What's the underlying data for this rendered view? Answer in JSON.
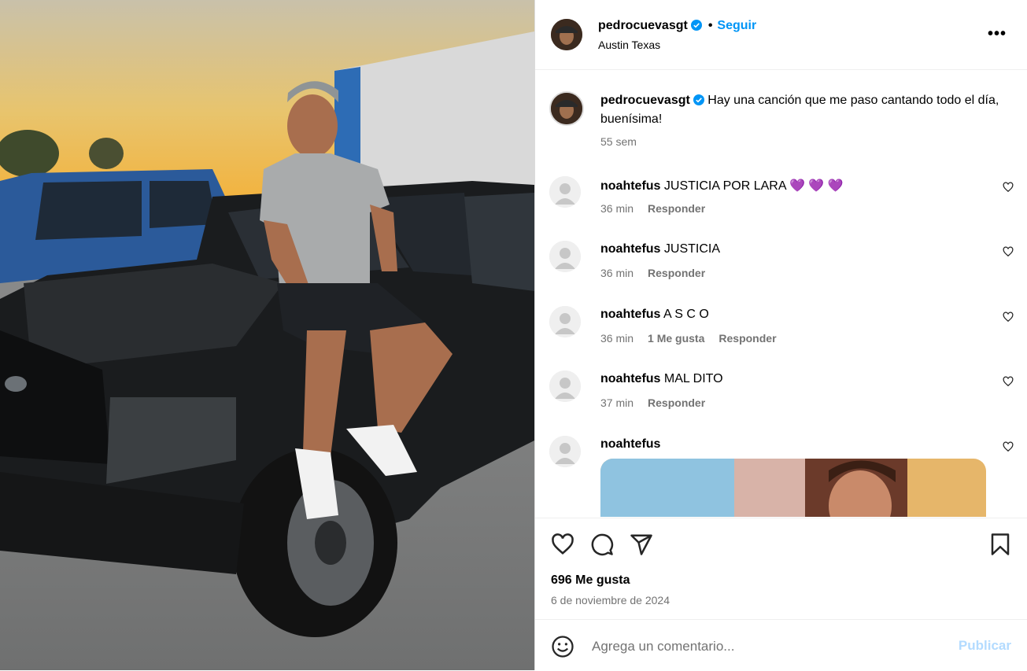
{
  "post": {
    "username": "pedrocuevasgt",
    "follow_label": "Seguir",
    "location": "Austin Texas",
    "more_label": "•••",
    "separator": "•"
  },
  "caption": {
    "username": "pedrocuevasgt",
    "text": "Hay una canción que me paso cantando todo el día, buenísima!",
    "time": "55 sem"
  },
  "comments": [
    {
      "username": "noahtefus",
      "text": "JUSTICIA POR LARA 💜 💜 💜",
      "time": "36 min",
      "likes": "",
      "reply": "Responder"
    },
    {
      "username": "noahtefus",
      "text": "JUSTICIA",
      "time": "36 min",
      "likes": "",
      "reply": "Responder"
    },
    {
      "username": "noahtefus",
      "text": "A S C O",
      "time": "36 min",
      "likes": "1 Me gusta",
      "reply": "Responder"
    },
    {
      "username": "noahtefus",
      "text": "MAL DITO",
      "time": "37 min",
      "likes": "",
      "reply": "Responder"
    },
    {
      "username": "noahtefus",
      "text": "",
      "time": "",
      "likes": "",
      "reply": ""
    }
  ],
  "stats": {
    "likes": "696 Me gusta",
    "date": "6 de noviembre de 2024"
  },
  "composer": {
    "placeholder": "Agrega un comentario...",
    "publish_label": "Publicar"
  },
  "colors": {
    "accent": "#0095f6",
    "publish_disabled": "#b3dbff",
    "secondary_text": "#737373",
    "verified": "#0095f6"
  },
  "icons": [
    "heart-icon",
    "comment-icon",
    "share-icon",
    "bookmark-icon",
    "emoji-icon",
    "verified-icon",
    "more-icon"
  ]
}
